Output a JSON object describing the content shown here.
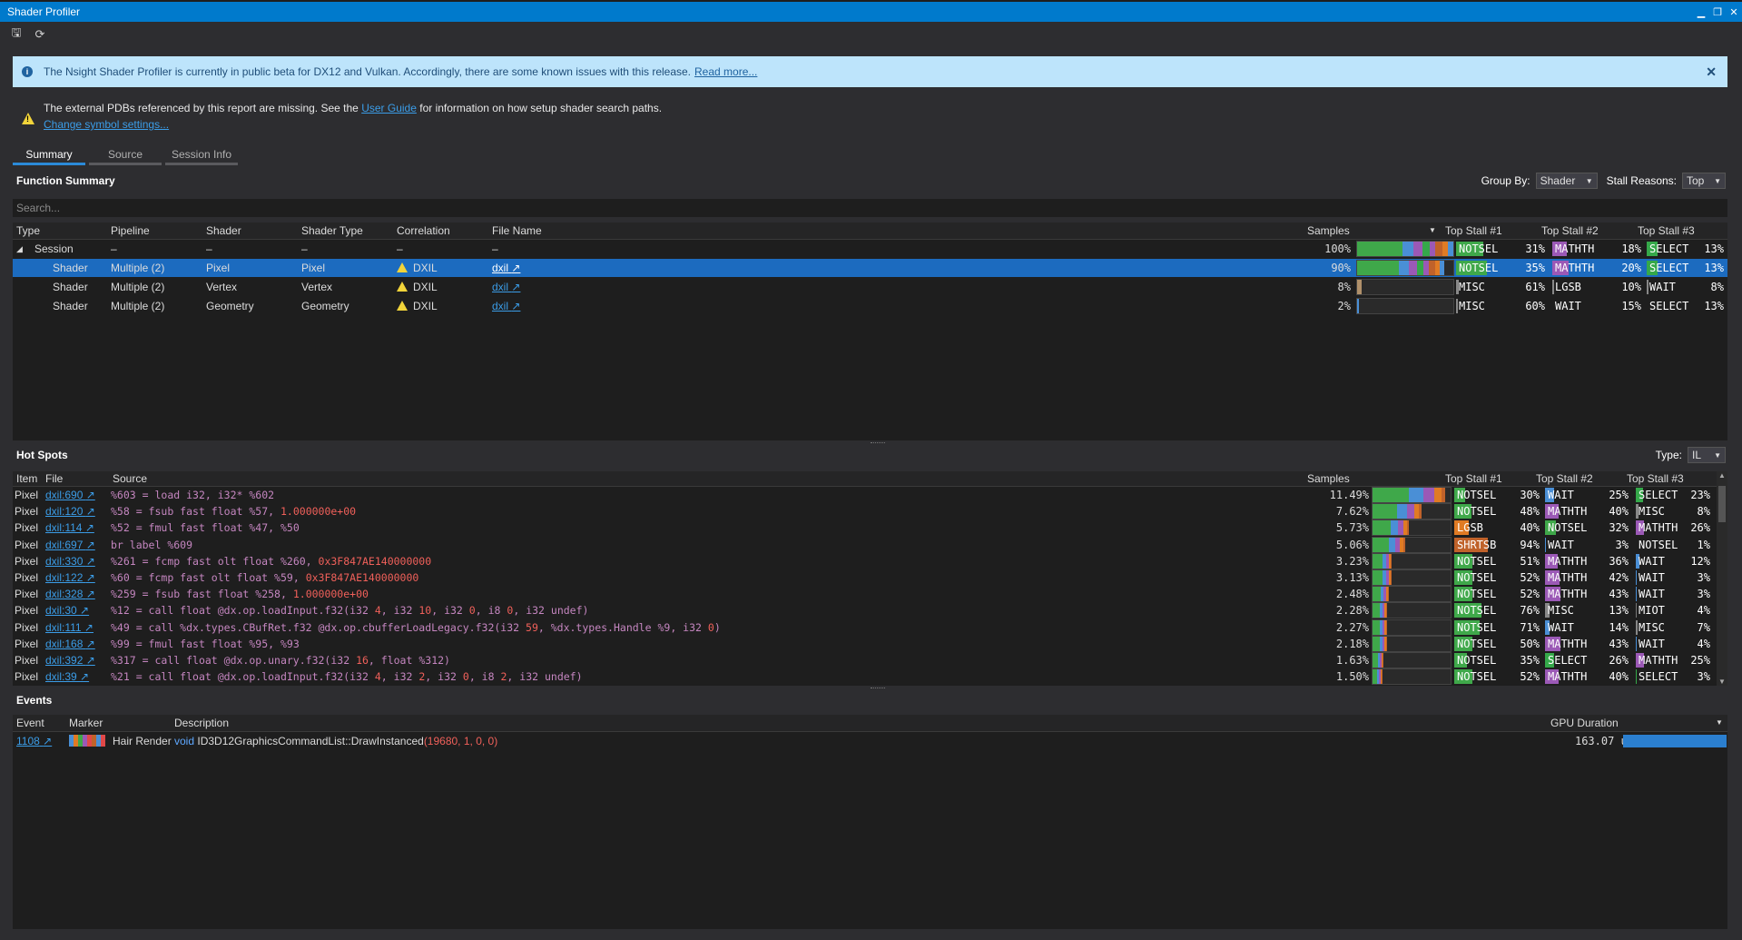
{
  "window": {
    "title": "Shader Profiler"
  },
  "info_banner": {
    "text": "The Nsight Shader Profiler is currently in public beta for DX12 and Vulkan. Accordingly, there are some known issues with this release.",
    "link": "Read more..."
  },
  "warning": {
    "text_before": "The external PDBs referenced by this report are missing. See the",
    "link": "User Guide",
    "text_after": "for information on how setup shader search paths.",
    "settings_link": "Change symbol settings..."
  },
  "tabs": [
    "Summary",
    "Source",
    "Session Info"
  ],
  "function_summary": {
    "title": "Function Summary",
    "group_by_label": "Group By:",
    "group_by_value": "Shader",
    "stall_reasons_label": "Stall Reasons:",
    "stall_reasons_value": "Top",
    "search_placeholder": "Search...",
    "columns": [
      "Type",
      "Pipeline",
      "Shader",
      "Shader Type",
      "Correlation",
      "File Name",
      "Samples",
      "Top Stall #1",
      "Top Stall #2",
      "Top Stall #3"
    ],
    "rows": [
      {
        "type": "Session",
        "pipeline": "–",
        "shader": "–",
        "shader_type": "–",
        "correlation": "–",
        "file": "–",
        "samples": "100%",
        "s1": "NOTSEL",
        "p1": "31%",
        "s2": "MATHTH",
        "p2": "18%",
        "s3": "SELECT",
        "p3": "13%"
      },
      {
        "type": "Shader",
        "pipeline": "Multiple (2)",
        "shader": "Pixel",
        "shader_type": "Pixel",
        "correlation": "DXIL",
        "file": "dxil",
        "samples": "90%",
        "s1": "NOTSEL",
        "p1": "35%",
        "s2": "MATHTH",
        "p2": "20%",
        "s3": "SELECT",
        "p3": "13%"
      },
      {
        "type": "Shader",
        "pipeline": "Multiple (2)",
        "shader": "Vertex",
        "shader_type": "Vertex",
        "correlation": "DXIL",
        "file": "dxil",
        "samples": "8%",
        "s1": "MISC",
        "p1": "61%",
        "s2": "LGSB",
        "p2": "10%",
        "s3": "WAIT",
        "p3": "8%"
      },
      {
        "type": "Shader",
        "pipeline": "Multiple (2)",
        "shader": "Geometry",
        "shader_type": "Geometry",
        "correlation": "DXIL",
        "file": "dxil",
        "samples": "2%",
        "s1": "MISC",
        "p1": "60%",
        "s2": "WAIT",
        "p2": "15%",
        "s3": "SELECT",
        "p3": "13%"
      }
    ]
  },
  "hot_spots": {
    "title": "Hot Spots",
    "type_label": "Type:",
    "type_value": "IL",
    "columns": [
      "Item",
      "File",
      "Source",
      "Samples",
      "Top Stall #1",
      "Top Stall #2",
      "Top Stall #3"
    ],
    "rows": [
      {
        "item": "Pixel",
        "file": "dxil:690",
        "src": "%603 = load i32, i32* %602",
        "samples": "11.49%",
        "s1": "NOTSEL",
        "p1": "30%",
        "s2": "WAIT",
        "p2": "25%",
        "s3": "SELECT",
        "p3": "23%"
      },
      {
        "item": "Pixel",
        "file": "dxil:120",
        "src": "%58 = fsub fast float %57, 1.000000e+00",
        "samples": "7.62%",
        "s1": "NOTSEL",
        "p1": "48%",
        "s2": "MATHTH",
        "p2": "40%",
        "s3": "MISC",
        "p3": "8%"
      },
      {
        "item": "Pixel",
        "file": "dxil:114",
        "src": "%52 = fmul fast float %47, %50",
        "samples": "5.73%",
        "s1": "LGSB",
        "p1": "40%",
        "s2": "NOTSEL",
        "p2": "32%",
        "s3": "MATHTH",
        "p3": "26%"
      },
      {
        "item": "Pixel",
        "file": "dxil:697",
        "src": "br label %609",
        "samples": "5.06%",
        "s1": "SHRTSB",
        "p1": "94%",
        "s2": "WAIT",
        "p2": "3%",
        "s3": "NOTSEL",
        "p3": "1%"
      },
      {
        "item": "Pixel",
        "file": "dxil:330",
        "src": "%261 = fcmp fast olt float %260, 0x3F847AE140000000",
        "samples": "3.23%",
        "s1": "NOTSEL",
        "p1": "51%",
        "s2": "MATHTH",
        "p2": "36%",
        "s3": "WAIT",
        "p3": "12%"
      },
      {
        "item": "Pixel",
        "file": "dxil:122",
        "src": "%60 = fcmp fast olt float %59, 0x3F847AE140000000",
        "samples": "3.13%",
        "s1": "NOTSEL",
        "p1": "52%",
        "s2": "MATHTH",
        "p2": "42%",
        "s3": "WAIT",
        "p3": "3%"
      },
      {
        "item": "Pixel",
        "file": "dxil:328",
        "src": "%259 = fsub fast float %258, 1.000000e+00",
        "samples": "2.48%",
        "s1": "NOTSEL",
        "p1": "52%",
        "s2": "MATHTH",
        "p2": "43%",
        "s3": "WAIT",
        "p3": "3%"
      },
      {
        "item": "Pixel",
        "file": "dxil:30",
        "src": "%12 = call float @dx.op.loadInput.f32(i32 4, i32 10, i32 0, i8 0, i32 undef)",
        "samples": "2.28%",
        "s1": "NOTSEL",
        "p1": "76%",
        "s2": "MISC",
        "p2": "13%",
        "s3": "MIOT",
        "p3": "4%"
      },
      {
        "item": "Pixel",
        "file": "dxil:111",
        "src": "%49 = call %dx.types.CBufRet.f32 @dx.op.cbufferLoadLegacy.f32(i32 59, %dx.types.Handle %9, i32 0)",
        "samples": "2.27%",
        "s1": "NOTSEL",
        "p1": "71%",
        "s2": "WAIT",
        "p2": "14%",
        "s3": "MISC",
        "p3": "7%"
      },
      {
        "item": "Pixel",
        "file": "dxil:168",
        "src": "%99 = fmul fast float %95, %93",
        "samples": "2.18%",
        "s1": "NOTSEL",
        "p1": "50%",
        "s2": "MATHTH",
        "p2": "43%",
        "s3": "WAIT",
        "p3": "4%"
      },
      {
        "item": "Pixel",
        "file": "dxil:392",
        "src": "%317 = call float @dx.op.unary.f32(i32 16, float %312)",
        "samples": "1.63%",
        "s1": "NOTSEL",
        "p1": "35%",
        "s2": "SELECT",
        "p2": "26%",
        "s3": "MATHTH",
        "p3": "25%"
      },
      {
        "item": "Pixel",
        "file": "dxil:39",
        "src": "%21 = call float @dx.op.loadInput.f32(i32 4, i32 2, i32 0, i8 2, i32 undef)",
        "samples": "1.50%",
        "s1": "NOTSEL",
        "p1": "52%",
        "s2": "MATHTH",
        "p2": "40%",
        "s3": "SELECT",
        "p3": "3%"
      }
    ]
  },
  "events": {
    "title": "Events",
    "columns": [
      "Event",
      "Marker",
      "Description",
      "GPU Duration"
    ],
    "rows": [
      {
        "event": "1108",
        "marker": "Hair Render",
        "desc_kw": "void",
        "desc_fn": "ID3D12GraphicsCommandList::DrawInstanced",
        "desc_args": "(19680, 1, 0, 0)",
        "duration": "163.07 us"
      }
    ]
  },
  "colors": {
    "accent": "#007acc",
    "selected_row": "#1c6bbf",
    "NOTSEL": "#3fa84a",
    "MATHTH": "#9b59b6",
    "SELECT": "#35a84a",
    "WAIT": "#4a8fd6",
    "LGSB": "#e07b24",
    "SHRTSB": "#c0622a",
    "MISC": "#888888",
    "MIOT": "#777777"
  }
}
